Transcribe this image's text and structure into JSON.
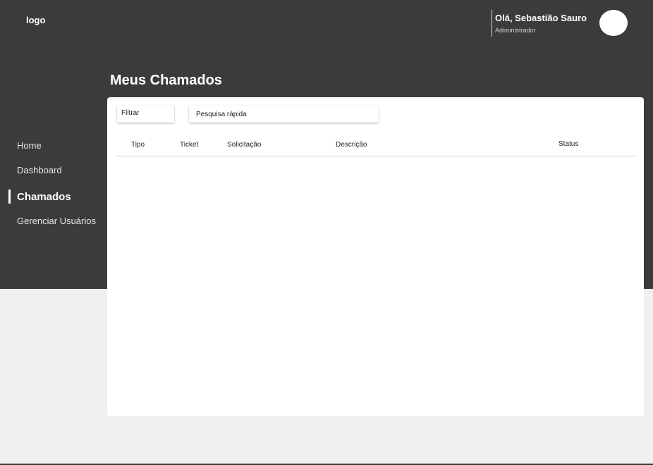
{
  "header": {
    "logo": "logo",
    "user_greeting": "Olá, Sebastião Sauro",
    "user_role": "Adiministrador"
  },
  "page": {
    "title": "Meus Chamados"
  },
  "sidebar": {
    "items": [
      {
        "label": "Home"
      },
      {
        "label": "Dashboard"
      },
      {
        "label": "Chamados",
        "active": true
      },
      {
        "label": "Gerenciar Usuários"
      }
    ]
  },
  "toolbar": {
    "filter_label": "Filtrar",
    "search_placeholder": "Pesquisa rápida"
  },
  "table": {
    "columns": [
      "Tipo",
      "Ticket",
      "Solicitação",
      "Descrição",
      "Status"
    ],
    "rows": []
  },
  "colors": {
    "dark_band": "#3b3b3b",
    "page_background": "#efefef",
    "card": "#ffffff"
  }
}
